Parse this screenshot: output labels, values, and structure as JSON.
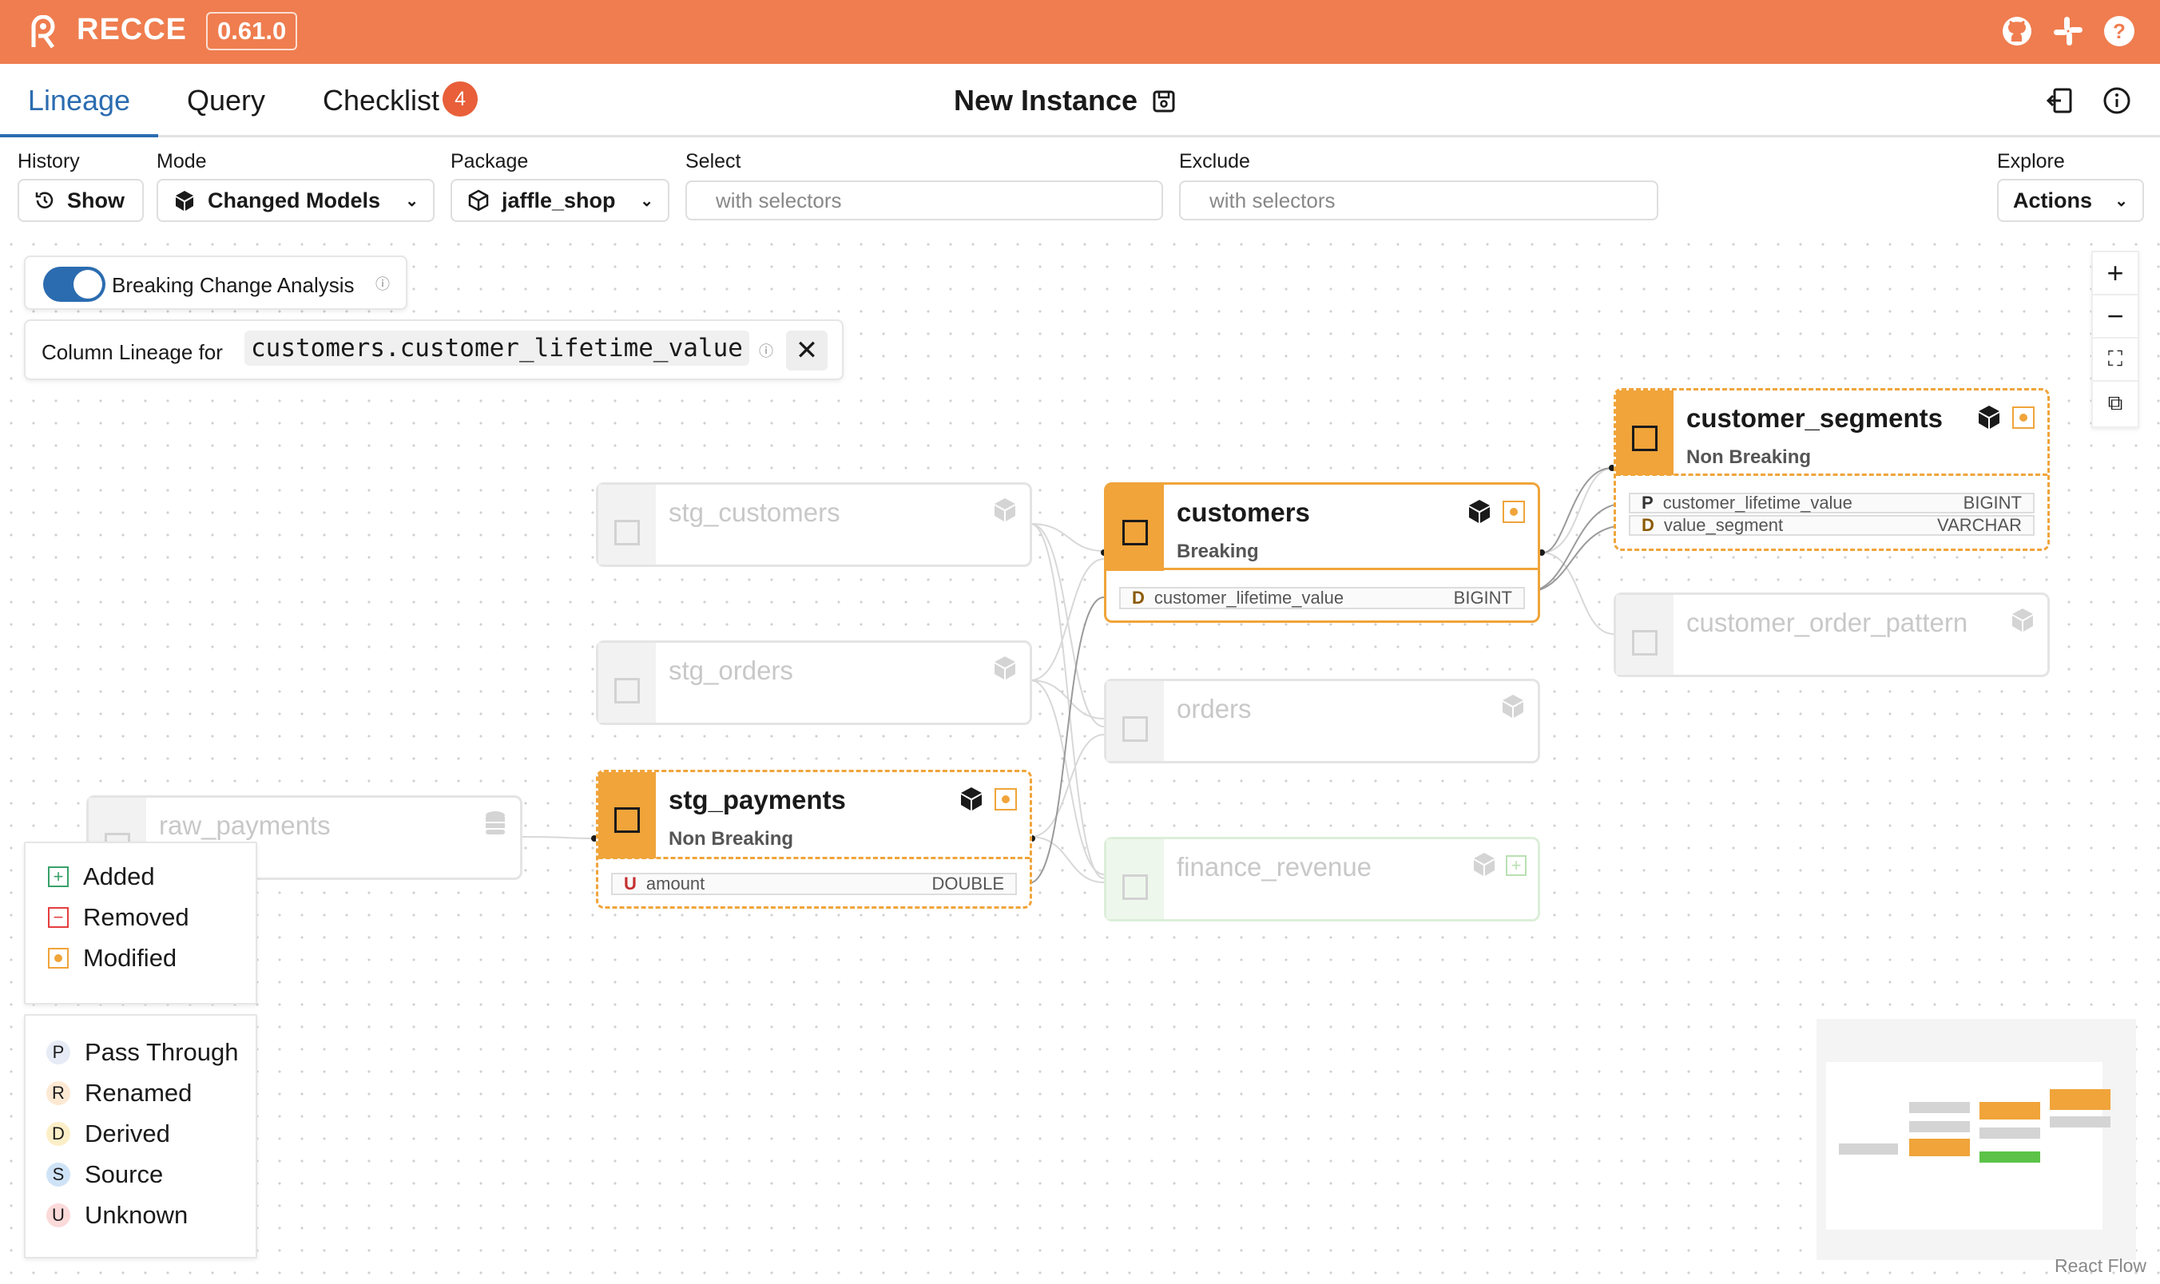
{
  "app": {
    "brand": "RECCE",
    "version": "0.61.0"
  },
  "tabs": [
    {
      "label": "Lineage"
    },
    {
      "label": "Query"
    },
    {
      "label": "Checklist",
      "badge": "4"
    }
  ],
  "instance_title": "New Instance",
  "toolbar": {
    "history": {
      "label": "History",
      "button": "Show"
    },
    "mode": {
      "label": "Mode",
      "value": "Changed Models"
    },
    "package": {
      "label": "Package",
      "value": "jaffle_shop"
    },
    "select": {
      "label": "Select",
      "placeholder": "with selectors"
    },
    "exclude": {
      "label": "Exclude",
      "placeholder": "with selectors"
    },
    "explore": {
      "label": "Explore",
      "button": "Actions"
    }
  },
  "breaking_change": {
    "label": "Breaking Change Analysis",
    "enabled": true
  },
  "column_lineage": {
    "label": "Column Lineage for",
    "column": "customers.customer_lifetime_value"
  },
  "nodes": {
    "stg_customers": {
      "name": "stg_customers"
    },
    "stg_orders": {
      "name": "stg_orders"
    },
    "stg_payments": {
      "name": "stg_payments",
      "status": "Non Breaking",
      "columns": [
        {
          "kind": "U",
          "name": "amount",
          "type": "DOUBLE"
        }
      ]
    },
    "raw_payments": {
      "name": "raw_payments"
    },
    "customers": {
      "name": "customers",
      "status": "Breaking",
      "columns": [
        {
          "kind": "D",
          "name": "customer_lifetime_value",
          "type": "BIGINT"
        }
      ]
    },
    "orders": {
      "name": "orders"
    },
    "finance_revenue": {
      "name": "finance_revenue"
    },
    "customer_segments": {
      "name": "customer_segments",
      "status": "Non Breaking",
      "columns": [
        {
          "kind": "P",
          "name": "customer_lifetime_value",
          "type": "BIGINT"
        },
        {
          "kind": "D",
          "name": "value_segment",
          "type": "VARCHAR"
        }
      ]
    },
    "customer_order_pattern": {
      "name": "customer_order_pattern"
    }
  },
  "legend_change": [
    {
      "label": "Added",
      "color": "#38a169"
    },
    {
      "label": "Removed",
      "color": "#e53e3e"
    },
    {
      "label": "Modified",
      "color": "#f0a43a"
    }
  ],
  "legend_column": [
    {
      "letter": "P",
      "label": "Pass Through",
      "bg": "#e6ebf5"
    },
    {
      "letter": "R",
      "label": "Renamed",
      "bg": "#fde9d3"
    },
    {
      "letter": "D",
      "label": "Derived",
      "bg": "#fcefc7"
    },
    {
      "letter": "S",
      "label": "Source",
      "bg": "#cfe3f7"
    },
    {
      "letter": "U",
      "label": "Unknown",
      "bg": "#fbdada"
    }
  ],
  "footer": {
    "attribution": "React Flow"
  }
}
